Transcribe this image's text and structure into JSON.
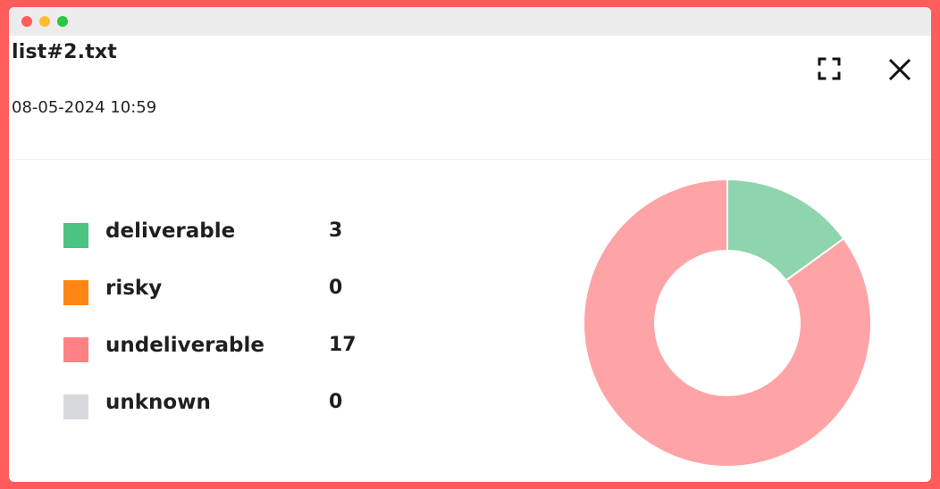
{
  "window": {
    "title": "list#2.txt",
    "date": "08-05-2024 10:59"
  },
  "icons": {
    "expand": "expand-icon",
    "close": "close-icon"
  },
  "colors": {
    "deliverable": "#4cc283",
    "risky": "#ff8515",
    "undeliverable": "#ff8185",
    "unknown": "#d7d9dc",
    "slice_deliverable": "#8ed4ad",
    "slice_undeliverable": "#fea3a6"
  },
  "legend": [
    {
      "label": "deliverable",
      "count": "3"
    },
    {
      "label": "risky",
      "count": "0"
    },
    {
      "label": "undeliverable",
      "count": "17"
    },
    {
      "label": "unknown",
      "count": "0"
    }
  ],
  "chart_data": {
    "type": "pie",
    "donut": true,
    "categories": [
      "deliverable",
      "risky",
      "undeliverable",
      "unknown"
    ],
    "values": [
      3,
      0,
      17,
      0
    ],
    "colors": [
      "#8ed4ad",
      "#ff8515",
      "#fea3a6",
      "#d7d9dc"
    ],
    "legend_position": "left"
  }
}
